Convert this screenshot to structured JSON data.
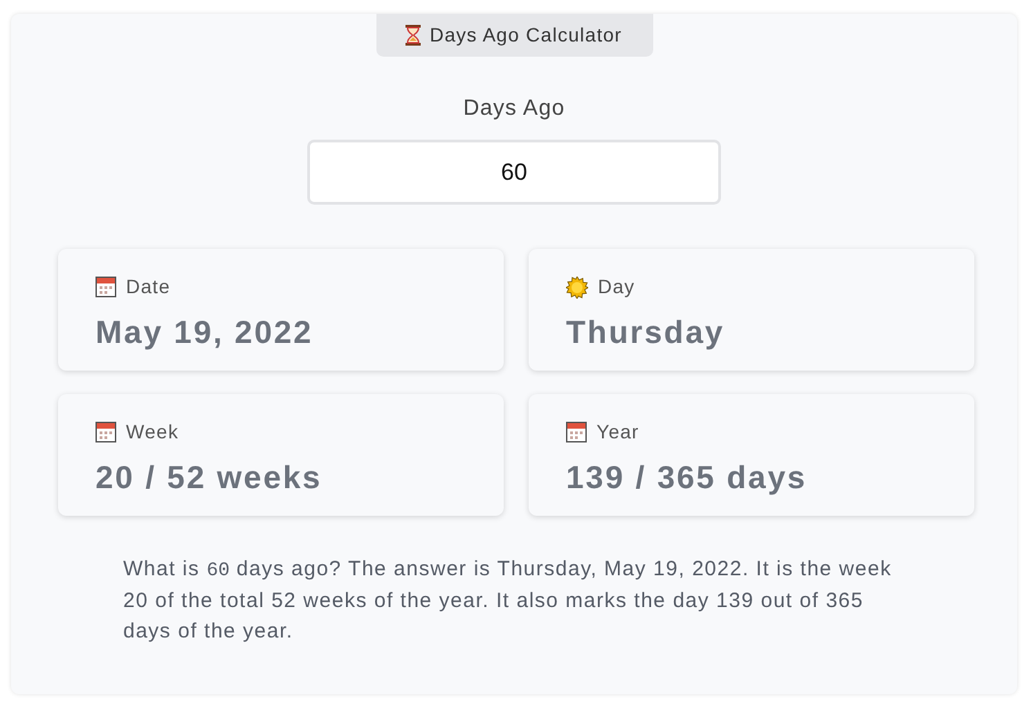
{
  "badge": {
    "kind": "hourglass",
    "label": "Days Ago Calculator"
  },
  "input": {
    "label": "Days Ago",
    "value": "60"
  },
  "results": [
    {
      "kind": "calendar",
      "label": "Date",
      "value": "May 19, 2022"
    },
    {
      "kind": "sun",
      "label": "Day",
      "value": "Thursday"
    },
    {
      "kind": "calendar",
      "label": "Week",
      "value": "20 / 52 weeks"
    },
    {
      "kind": "calendar",
      "label": "Year",
      "value": "139 / 365 days"
    }
  ],
  "summary": [
    {
      "kind": "text",
      "text": "What is "
    },
    {
      "kind": "code",
      "text": "60"
    },
    {
      "kind": "text",
      "text": " days ago? The answer is Thursday, May 19, 2022. It is the week 20 of the total 52 weeks of the year. It also marks the day 139 out of 365 days of the year."
    }
  ]
}
